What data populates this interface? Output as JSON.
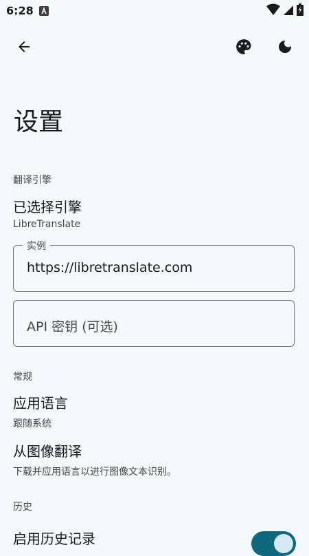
{
  "status_bar": {
    "time": "6:28"
  },
  "app_bar": {
    "back_icon": "arrow-back-icon",
    "palette_icon": "palette-icon",
    "theme_icon": "dark-mode-icon"
  },
  "page": {
    "title": "设置"
  },
  "engine_section": {
    "label": "翻译引擎",
    "selected_engine_title": "已选择引擎",
    "selected_engine_value": "LibreTranslate",
    "instance_label": "实例",
    "instance_value": "https://libretranslate.com",
    "api_key_placeholder": "API 密钥 (可选)"
  },
  "general_section": {
    "label": "常规",
    "app_language_title": "应用语言",
    "app_language_value": "跟随系统",
    "image_translate_title": "从图像翻译",
    "image_translate_summary": "下载并应用语言以进行图像文本识别。"
  },
  "history_section": {
    "label": "历史",
    "enable_history_title": "启用历史记录",
    "enable_history_on": true
  },
  "colors": {
    "background": "#f4f9fc",
    "accent": "#0f6780"
  }
}
